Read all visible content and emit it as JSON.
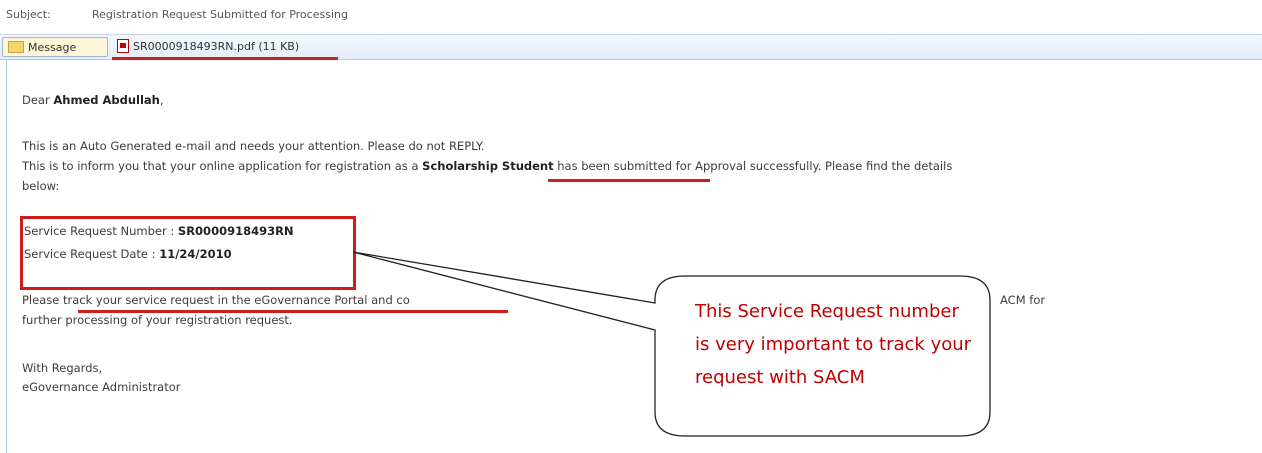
{
  "header": {
    "subject_label": "Subject:",
    "subject_value": "Registration Request Submitted for Processing"
  },
  "tabs": [
    {
      "label": "Message",
      "icon": "envelope-icon"
    },
    {
      "label": "SR0000918493RN.pdf (11 KB)",
      "icon": "pdf-icon"
    }
  ],
  "email": {
    "greeting_prefix": "Dear",
    "recipient_name": "Ahmed Abdullah",
    "greeting_suffix": ",",
    "line1": "This is an Auto Generated e-mail and needs your attention.  Please do not REPLY.",
    "line2_prefix": "This is to inform you that your online application for registration as a",
    "line2_highlight": "Scholarship Student",
    "line2_suffix": "has been submitted for Approval successfully. Please find the details",
    "line3": "below:",
    "sr_number_label": "Service Request Number :",
    "sr_number_value": "SR0000918493RN",
    "sr_date_label": "Service Request Date      :",
    "sr_date_value": "11/24/2010",
    "para_prefix": "Please",
    "para_link": "track your service request in the eGovernance Portal and co",
    "para_end": "ACM for",
    "para_line2": "further processing of your registration request.",
    "closing": "With Regards,",
    "signature": "eGovernance Administrator"
  },
  "callout": {
    "text": "This Service Request number is very important to track your request with SACM"
  },
  "colors": {
    "annotation_red": "#cc1f1f",
    "callout_text": "#c00000",
    "tab_bar": "#e3ecf8"
  }
}
